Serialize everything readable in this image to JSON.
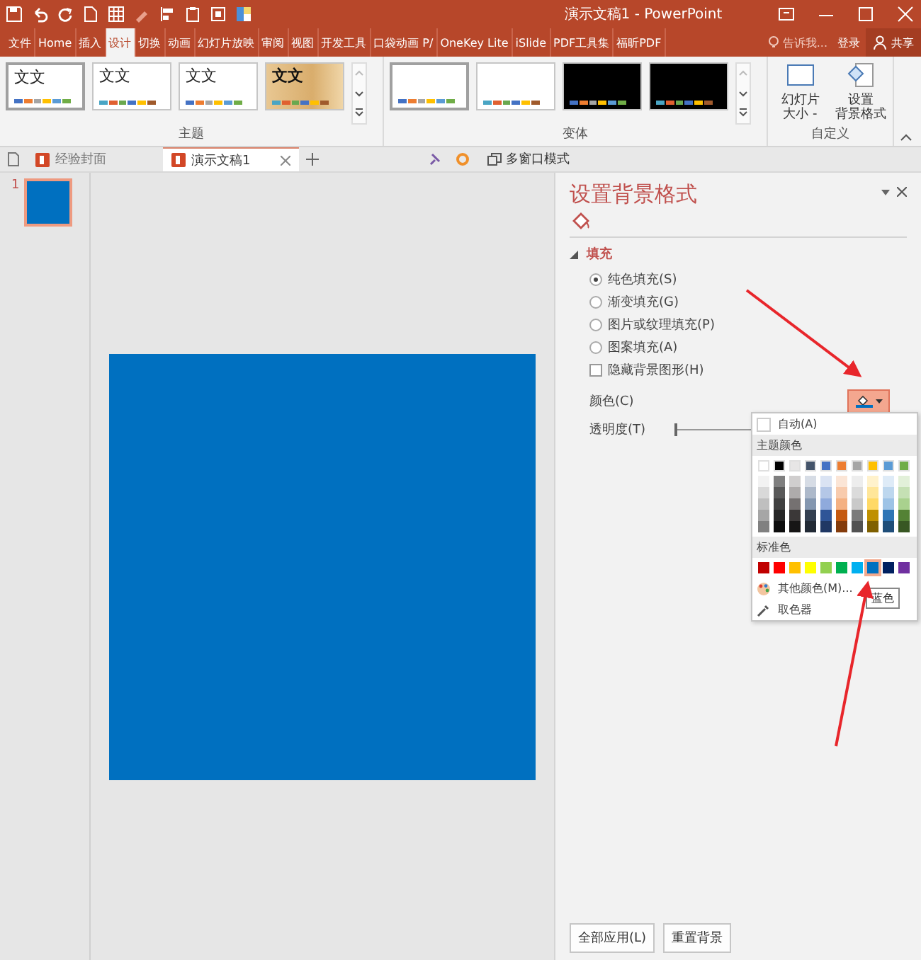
{
  "window": {
    "title": "演示文稿1 - PowerPoint"
  },
  "ribbon_tabs": [
    {
      "label": "文件",
      "selected": false
    },
    {
      "label": "Home",
      "selected": false
    },
    {
      "label": "插入",
      "selected": false
    },
    {
      "label": "设计",
      "selected": true
    },
    {
      "label": "切换",
      "selected": false
    },
    {
      "label": "动画",
      "selected": false
    },
    {
      "label": "幻灯片放映",
      "selected": false
    },
    {
      "label": "审阅",
      "selected": false
    },
    {
      "label": "视图",
      "selected": false
    },
    {
      "label": "开发工具",
      "selected": false
    },
    {
      "label": "口袋动画 P/",
      "selected": false
    },
    {
      "label": "OneKey Lite",
      "selected": false
    },
    {
      "label": "iSlide",
      "selected": false
    },
    {
      "label": "PDF工具集",
      "selected": false
    },
    {
      "label": "福昕PDF",
      "selected": false
    }
  ],
  "tell_me": "告诉我...",
  "sign_in": "登录",
  "share": "共享",
  "themes": {
    "label": "主题",
    "items": [
      {
        "label": "文文",
        "kind": "plain",
        "selected": true
      },
      {
        "label": "文文",
        "kind": "plain",
        "selected": false
      },
      {
        "label": "文文",
        "kind": "plain",
        "selected": false
      },
      {
        "label": "文文",
        "kind": "wood",
        "selected": false
      }
    ]
  },
  "variants": {
    "label": "变体",
    "items": [
      {
        "kind": "light",
        "selected": true
      },
      {
        "kind": "light",
        "selected": false
      },
      {
        "kind": "dark",
        "selected": false
      },
      {
        "kind": "dark",
        "selected": false
      }
    ]
  },
  "customize": {
    "label": "自定义",
    "buttons": [
      {
        "kind": "slide-size",
        "lines": [
          "幻灯片",
          "大小 -"
        ]
      },
      {
        "kind": "format-background",
        "lines": [
          "设置",
          "背景格式"
        ]
      }
    ]
  },
  "doc_tabs": [
    {
      "label": "经验封面",
      "selected": false
    },
    {
      "label": "演示文稿1",
      "selected": true
    }
  ],
  "multi_window": "多窗口模式",
  "slides": [
    {
      "number": "1",
      "selected": true,
      "color": "#0070c0"
    }
  ],
  "format_pane": {
    "title": "设置背景格式",
    "section": {
      "label": "填充",
      "expanded": true
    },
    "fill_options": [
      {
        "label": "纯色填充(S)",
        "selected": true
      },
      {
        "label": "渐变填充(G)",
        "selected": false
      },
      {
        "label": "图片或纹理填充(P)",
        "selected": false
      },
      {
        "label": "图案填充(A)",
        "selected": false
      }
    ],
    "hide_graphics": {
      "label": "隐藏背景图形(H)",
      "checked": false
    },
    "color_label": "颜色(C)",
    "transparency_label": "透明度(T)",
    "transparency": {
      "level": 0
    },
    "buttons": [
      "全部应用(L)",
      "重置背景"
    ]
  },
  "color_picker": {
    "auto": "自动(A)",
    "theme_label": "主题颜色",
    "theme_colors": [
      {
        "color": "#ffffff",
        "shades": [
          {
            "color": "#f2f2f2"
          },
          {
            "color": "#d9d9d9"
          },
          {
            "color": "#bfbfbf"
          },
          {
            "color": "#a6a6a6"
          },
          {
            "color": "#808080"
          }
        ]
      },
      {
        "color": "#000000",
        "shades": [
          {
            "color": "#7f7f7f"
          },
          {
            "color": "#595959"
          },
          {
            "color": "#404040"
          },
          {
            "color": "#262626"
          },
          {
            "color": "#0d0d0d"
          }
        ]
      },
      {
        "color": "#e7e6e6",
        "shades": [
          {
            "color": "#d0cece"
          },
          {
            "color": "#aeabab"
          },
          {
            "color": "#757171"
          },
          {
            "color": "#3b3838"
          },
          {
            "color": "#171616"
          }
        ]
      },
      {
        "color": "#44546a",
        "shades": [
          {
            "color": "#d6dce5"
          },
          {
            "color": "#adb9ca"
          },
          {
            "color": "#8497b0"
          },
          {
            "color": "#333f50"
          },
          {
            "color": "#222a35"
          }
        ]
      },
      {
        "color": "#4472c4",
        "shades": [
          {
            "color": "#dae3f3"
          },
          {
            "color": "#b4c7e7"
          },
          {
            "color": "#8faadc"
          },
          {
            "color": "#2f5597"
          },
          {
            "color": "#203864"
          }
        ]
      },
      {
        "color": "#ed7d31",
        "shades": [
          {
            "color": "#fbe5d6"
          },
          {
            "color": "#f8cbad"
          },
          {
            "color": "#f4b183"
          },
          {
            "color": "#c55a11"
          },
          {
            "color": "#843c0c"
          }
        ]
      },
      {
        "color": "#a5a5a5",
        "shades": [
          {
            "color": "#ededed"
          },
          {
            "color": "#dbdbdb"
          },
          {
            "color": "#c9c9c9"
          },
          {
            "color": "#7b7b7b"
          },
          {
            "color": "#525252"
          }
        ]
      },
      {
        "color": "#ffc000",
        "shades": [
          {
            "color": "#fff2cc"
          },
          {
            "color": "#ffe699"
          },
          {
            "color": "#ffd966"
          },
          {
            "color": "#bf9000"
          },
          {
            "color": "#7f6000"
          }
        ]
      },
      {
        "color": "#5b9bd5",
        "shades": [
          {
            "color": "#deebf7"
          },
          {
            "color": "#bdd7ee"
          },
          {
            "color": "#9dc3e6"
          },
          {
            "color": "#2e75b6"
          },
          {
            "color": "#1f4e79"
          }
        ]
      },
      {
        "color": "#70ad47",
        "shades": [
          {
            "color": "#e2f0d9"
          },
          {
            "color": "#c5e0b4"
          },
          {
            "color": "#a9d18e"
          },
          {
            "color": "#548235"
          },
          {
            "color": "#385723"
          }
        ]
      }
    ],
    "standard_label": "标准色",
    "standard_colors": [
      {
        "color": "#c00000",
        "selected": false
      },
      {
        "color": "#ff0000",
        "selected": false
      },
      {
        "color": "#ffc000",
        "selected": false
      },
      {
        "color": "#ffff00",
        "selected": false
      },
      {
        "color": "#92d050",
        "selected": false
      },
      {
        "color": "#00b050",
        "selected": false
      },
      {
        "color": "#00b0f0",
        "selected": false
      },
      {
        "color": "#0070c0",
        "selected": true
      },
      {
        "color": "#002060",
        "selected": false
      },
      {
        "color": "#7030a0",
        "selected": false
      }
    ],
    "more_colors": "其他颜色(M)...",
    "eyedropper": "取色器",
    "tooltip": "蓝色"
  }
}
